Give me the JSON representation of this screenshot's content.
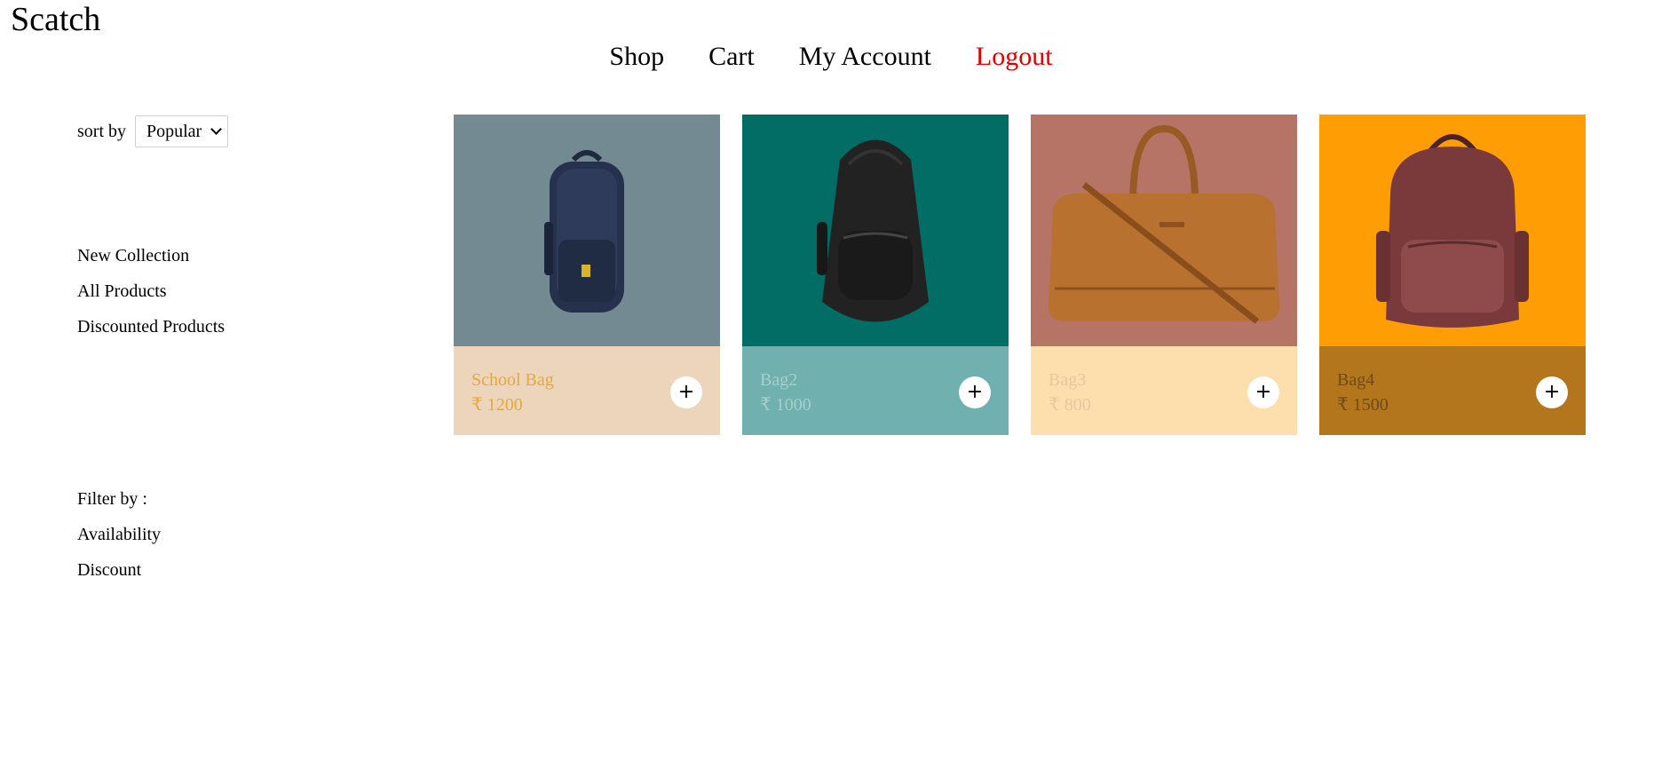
{
  "brand": "Scatch",
  "nav": {
    "shop": "Shop",
    "cart": "Cart",
    "account": "My Account",
    "logout": "Logout"
  },
  "sidebar": {
    "sort_label": "sort by",
    "sort_selected": "Popular",
    "collections": [
      "New Collection",
      "All Products",
      "Discounted Products"
    ],
    "filter_label": "Filter by :",
    "filters": [
      "Availability",
      "Discount"
    ]
  },
  "products": [
    {
      "name": "School Bag",
      "price": "₹ 1200",
      "bg": "#748a92",
      "panel": "#ecd5bb",
      "text": "#e5a93b",
      "image": "backpack-navy-image"
    },
    {
      "name": "Bag2",
      "price": "₹ 1000",
      "bg": "#016d64",
      "panel": "#70b0ae",
      "text": "#a6cfcc",
      "image": "backpack-black-image"
    },
    {
      "name": "Bag3",
      "price": "₹ 800",
      "bg": "#b67466",
      "panel": "#fddfae",
      "text": "#e6c8a0",
      "image": "duffel-bag-brown-image"
    },
    {
      "name": "Bag4",
      "price": "₹ 1500",
      "bg": "#fe9d04",
      "panel": "#b3761d",
      "text": "#6e4a1a",
      "image": "backpack-maroon-image"
    }
  ],
  "add_symbol": "+"
}
